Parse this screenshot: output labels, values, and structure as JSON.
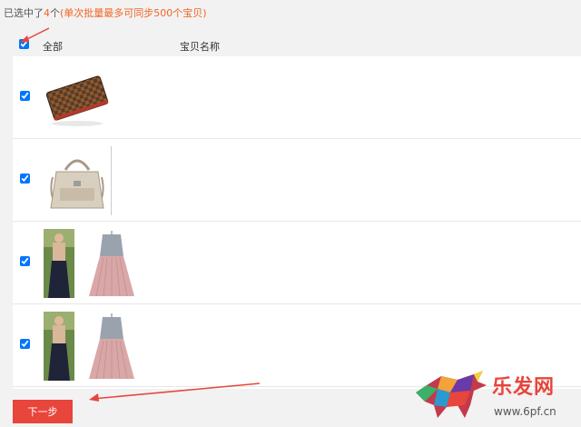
{
  "selection": {
    "prefix": "已选中了",
    "count": "4",
    "unit": "个",
    "note": "(单次批量最多可同步500个宝贝)"
  },
  "header": {
    "all_label": "全部",
    "name_label": "宝贝名称"
  },
  "items": [
    {
      "checked": true,
      "thumbs": [
        "wallet-image"
      ]
    },
    {
      "checked": true,
      "thumbs": [
        "handbag-image"
      ]
    },
    {
      "checked": true,
      "thumbs": [
        "model-dress-image",
        "dress-image"
      ]
    },
    {
      "checked": true,
      "thumbs": [
        "model-dress-image",
        "dress-image"
      ]
    }
  ],
  "next_button": "下一步",
  "watermark": {
    "brand": "乐发网",
    "url": "www.6pf.cn"
  },
  "colors": {
    "accent": "#f26522",
    "button": "#e8453c",
    "arrow": "#e8453c"
  }
}
